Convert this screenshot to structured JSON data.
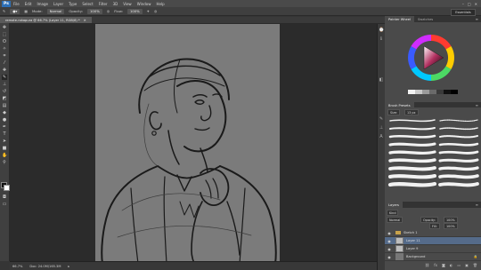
{
  "menu": {
    "logo": "Ps",
    "items": [
      "File",
      "Edit",
      "Image",
      "Layer",
      "Type",
      "Select",
      "Filter",
      "3D",
      "View",
      "Window",
      "Help"
    ],
    "window_controls": [
      "–",
      "□",
      "✕"
    ],
    "workspace": "Essentials"
  },
  "options": {
    "mode_label": "Mode:",
    "mode_value": "Normal",
    "opacity_label": "Opacity:",
    "opacity_value": "100%",
    "flow_label": "Flow:",
    "flow_value": "100%"
  },
  "document": {
    "tab_title": "remote-rokapura @ 66.7% (Layer 11, RGB/8) *",
    "close": "✕"
  },
  "status": {
    "zoom": "66.7%",
    "doc_size": "Doc: 24.0M/165.3M"
  },
  "panels": {
    "color_tabs": [
      "Painter Wheel",
      "Swatches"
    ],
    "brush_tabs": [
      "Brush Presets"
    ],
    "brush_size": "Size:",
    "brush_size_value": "13 px",
    "layers_tabs": [
      "Layers"
    ],
    "kind_label": "Kind",
    "blend_mode": "Normal",
    "opacity_label": "Opacity:",
    "opacity_value": "100%",
    "fill_label": "Fill:",
    "fill_value": "100%",
    "layers": [
      {
        "name": "Sketch 1",
        "type": "group"
      },
      {
        "name": "Layer 11",
        "type": "layer",
        "selected": true
      },
      {
        "name": "Layer 9",
        "type": "layer"
      },
      {
        "name": "Background",
        "type": "layer"
      }
    ]
  }
}
